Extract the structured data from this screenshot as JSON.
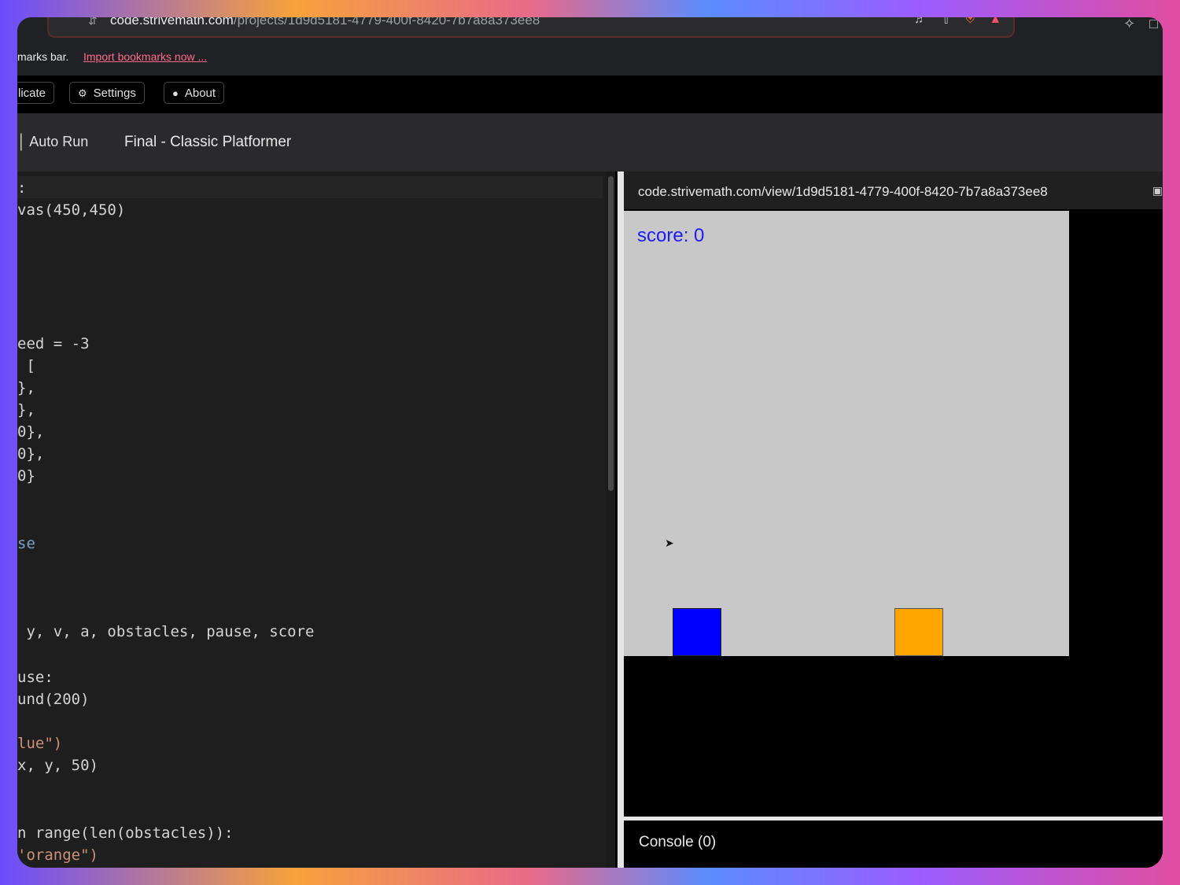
{
  "browser": {
    "url_host": "code.strivemath.com",
    "url_path": "/projects/1d9d5181-4779-400f-8420-7b7a8a373ee8",
    "bookmarks_label": "marks bar.",
    "bookmarks_link": "Import bookmarks now ...",
    "icons": [
      "tune-icon",
      "media-icon",
      "share-icon",
      "brave-shield-icon",
      "brave-rewards-icon",
      "extensions-icon",
      "window-icon"
    ]
  },
  "toolbar": {
    "duplicate_label": "licate",
    "settings_label": "Settings",
    "about_label": "About"
  },
  "tabbar": {
    "auto_run_label": "Auto Run",
    "project_title": "Final - Classic Platformer"
  },
  "editor": {
    "lines": [
      {
        "text": ":",
        "style": "plain"
      },
      {
        "text": "vas(450,450)",
        "style": "plain"
      },
      {
        "text": "eed = -3",
        "style": "plain"
      },
      {
        "text": " [",
        "style": "plain"
      },
      {
        "text": "},",
        "style": "plain"
      },
      {
        "text": "},",
        "style": "plain"
      },
      {
        "text": "0},",
        "style": "plain"
      },
      {
        "text": "0},",
        "style": "plain"
      },
      {
        "text": "0}",
        "style": "plain"
      },
      {
        "text": "se",
        "style": "kw"
      },
      {
        "text": " y, v, a, obstacles, pause, score",
        "style": "plain"
      },
      {
        "text": "use:",
        "style": "plain"
      },
      {
        "text": "und(200)",
        "style": "plain"
      },
      {
        "text": "lue\")",
        "style": "str"
      },
      {
        "text": "x, y, 50)",
        "style": "plain"
      },
      {
        "text": "n range(len(obstacles)):",
        "style": "plain"
      },
      {
        "text": "'orange\")",
        "style": "str"
      }
    ]
  },
  "preview": {
    "url": "code.strivemath.com/view/1d9d5181-4779-400f-8420-7b7a8a373ee8",
    "score_text": "score: 0",
    "console_label": "Console (0)",
    "colors": {
      "player": "#0000ff",
      "obstacle": "#ffa500",
      "canvas": "#c8c8c8",
      "score": "#1a1aff"
    }
  }
}
